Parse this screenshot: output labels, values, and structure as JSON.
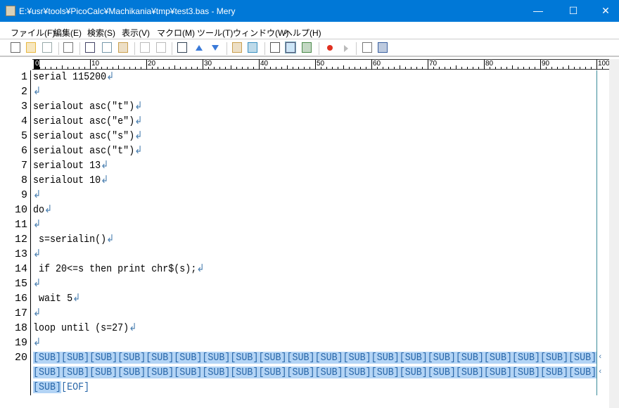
{
  "window": {
    "title": "E:¥usr¥tools¥PicoCalc¥Machikania¥tmp¥test3.bas - Mery",
    "minimize": "—",
    "maximize": "☐",
    "close": "✕"
  },
  "menu": [
    "ファイル(F)",
    "編集(E)",
    "検索(S)",
    "表示(V)",
    "マクロ(M)",
    "ツール(T)",
    "ウィンドウ(W)",
    "ヘルプ(H)"
  ],
  "toolbar": [
    "new-file",
    "open-file",
    "save",
    "print",
    "cut",
    "copy",
    "paste",
    "undo",
    "redo",
    "find",
    "find-previous",
    "find-next",
    "tag-jump",
    "web-search",
    "wrap-none",
    "wrap-window",
    "wrap-column",
    "record-macro",
    "run-macro",
    "plugin",
    "outline"
  ],
  "ruler": [
    "0",
    "10",
    "20",
    "30",
    "40",
    "50",
    "60",
    "70",
    "80",
    "90",
    "100"
  ],
  "editor": {
    "eol": "↲",
    "lines": [
      {
        "n": "1",
        "t": "serial 115200"
      },
      {
        "n": "2",
        "t": ""
      },
      {
        "n": "3",
        "t": "serialout asc(\"t\")"
      },
      {
        "n": "4",
        "t": "serialout asc(\"e\")"
      },
      {
        "n": "5",
        "t": "serialout asc(\"s\")"
      },
      {
        "n": "6",
        "t": "serialout asc(\"t\")"
      },
      {
        "n": "7",
        "t": "serialout 13"
      },
      {
        "n": "8",
        "t": "serialout 10"
      },
      {
        "n": "9",
        "t": ""
      },
      {
        "n": "10",
        "t": "do"
      },
      {
        "n": "11",
        "t": ""
      },
      {
        "n": "12",
        "t": " s=serialin()"
      },
      {
        "n": "13",
        "t": ""
      },
      {
        "n": "14",
        "t": " if 20<=s then print chr$(s);"
      },
      {
        "n": "15",
        "t": ""
      },
      {
        "n": "16",
        "t": " wait 5"
      },
      {
        "n": "17",
        "t": ""
      },
      {
        "n": "18",
        "t": "loop until (s=27)"
      },
      {
        "n": "19",
        "t": ""
      }
    ],
    "last": {
      "n": "20",
      "row1": "[SUB][SUB][SUB][SUB][SUB][SUB][SUB][SUB][SUB][SUB][SUB][SUB][SUB][SUB][SUB][SUB][SUB][SUB][SUB][SUB]",
      "row2": "[SUB][SUB][SUB][SUB][SUB][SUB][SUB][SUB][SUB][SUB][SUB][SUB][SUB][SUB][SUB][SUB][SUB][SUB][SUB][SUB]",
      "row3": "[SUB]",
      "eof": "[EOF]",
      "wrap": "‹"
    }
  }
}
